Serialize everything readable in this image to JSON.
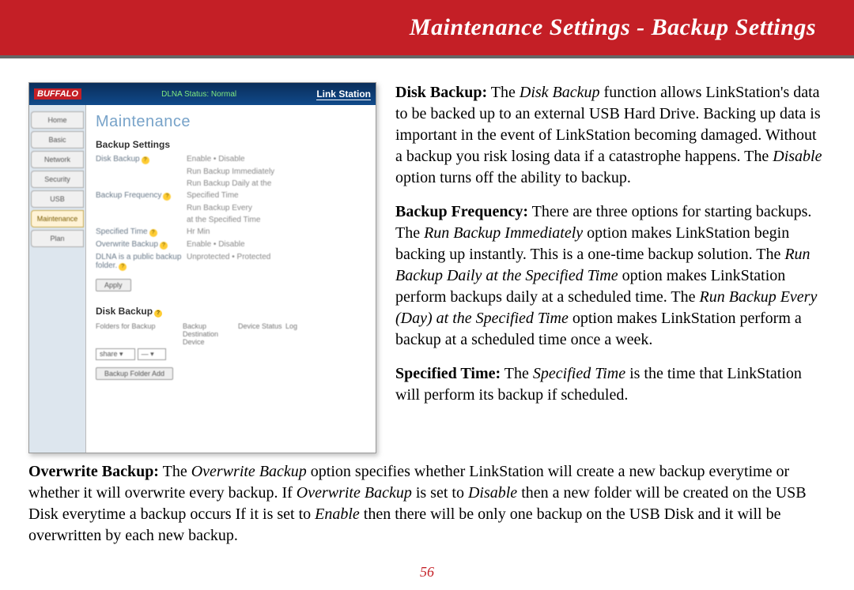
{
  "header": {
    "title": "Maintenance Settings - Backup Settings"
  },
  "screenshot": {
    "brand": "BUFFALO",
    "status": "DLNA Status: Normal",
    "product": "Link Station",
    "sidebar": [
      "Home",
      "Basic",
      "Network",
      "Security",
      "USB",
      "Maintenance",
      "Plan"
    ],
    "section_title": "Maintenance",
    "section_h2a": "Backup Settings",
    "rows": {
      "disk_backup": "Disk Backup",
      "disk_backup_opts": "Enable • Disable",
      "disk_backup_opt2": "Run Backup Immediately",
      "disk_backup_opt3": "Run Backup Daily at the",
      "backup_freq": "Backup Frequency",
      "backup_freq_opts": "Specified Time",
      "backup_freq_opt2": "Run Backup Every",
      "backup_freq_opt3": "at the Specified Time",
      "specified_time": "Specified Time",
      "specified_time_val": "  Hr   Min",
      "overwrite": "Overwrite Backup",
      "overwrite_opts": "Enable • Disable",
      "dlna": "DLNA is a public backup folder.",
      "dlna_opts": "Unprotected • Protected"
    },
    "apply": "Apply",
    "section_h2b": "Disk Backup",
    "table_headers": [
      "Folders for Backup",
      "Backup Destination Device",
      "Device Status",
      "Log"
    ],
    "addbtn": "Backup Folder Add"
  },
  "paragraphs": {
    "p1_lead": "Disk Backup:",
    "p1_body1": "  The ",
    "p1_em1": "Disk Backup",
    "p1_body2": " function allows LinkStation's data to be backed up to an external USB Hard Drive.  Backing up data is important in the event of LinkStation becoming damaged.  Without a backup you risk losing data if a catastrophe happens.  The ",
    "p1_em2": "Disable",
    "p1_body3": " option turns off the ability to backup.",
    "p2_lead": "Backup Frequency:",
    "p2_body1": "  There are three options for starting backups.  The ",
    "p2_em1": "Run Backup Immediately",
    "p2_body2": " option makes LinkStation begin backing up instantly.  This is a one-time backup solution.  The ",
    "p2_em2": "Run Backup Daily at the Specified Time",
    "p2_body3": " option makes LinkStation perform backups daily at a scheduled time.  The ",
    "p2_em3": "Run Backup Every (Day) at the Specified Time",
    "p2_body4": " option makes LinkStation perform a backup at a scheduled time once a week.",
    "p3_lead": "Specified Time:",
    "p3_body1": "  The ",
    "p3_em1": "Specified Time",
    "p3_body2": " is the time that LinkStation will perform its backup if scheduled.",
    "p4_lead": "Overwrite Backup:",
    "p4_body1": "  The ",
    "p4_em1": "Overwrite Backup",
    "p4_body2": " option specifies whether LinkStation will create a new backup everytime or whether it will overwrite every backup.  If ",
    "p4_em2": "Overwrite Backup",
    "p4_body3": " is set to ",
    "p4_em3": "Disable",
    "p4_body4": " then a new folder will be created on the USB Disk everytime a backup occurs  If it is set to ",
    "p4_em4": "Enable",
    "p4_body5": " then there will be only one backup on the USB Disk and it will be overwritten by each new backup."
  },
  "page_number": "56"
}
